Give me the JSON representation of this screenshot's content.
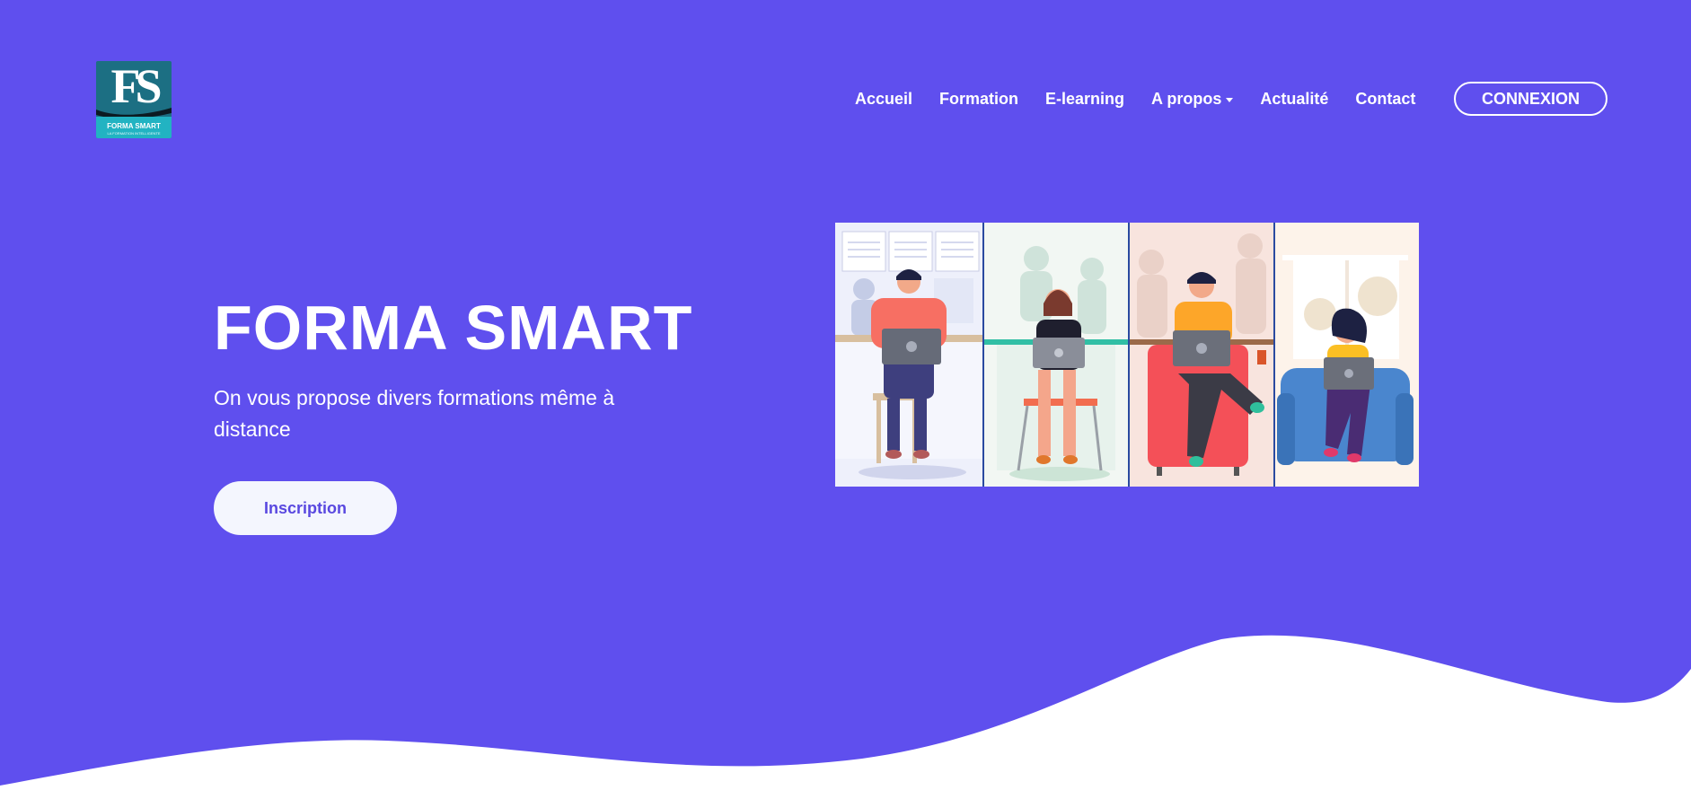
{
  "brand": {
    "logo_mark": "FS",
    "logo_name": "FORMA SMART",
    "logo_tagline": "LA FORMATION INTELLIGENTE"
  },
  "nav": {
    "items": [
      {
        "label": "Accueil"
      },
      {
        "label": "Formation"
      },
      {
        "label": "E-learning"
      },
      {
        "label": "A propos",
        "has_dropdown": true
      },
      {
        "label": "Actualité"
      },
      {
        "label": "Contact"
      }
    ],
    "login_label": "CONNEXION"
  },
  "hero": {
    "title": "FORMA SMART",
    "subtitle": "On vous propose divers formations même à distance",
    "cta_label": "Inscription"
  },
  "colors": {
    "background": "#5f4fee",
    "cta_text": "#5948e0",
    "logo_dark": "#1c6f83",
    "logo_light": "#22b3c2"
  }
}
